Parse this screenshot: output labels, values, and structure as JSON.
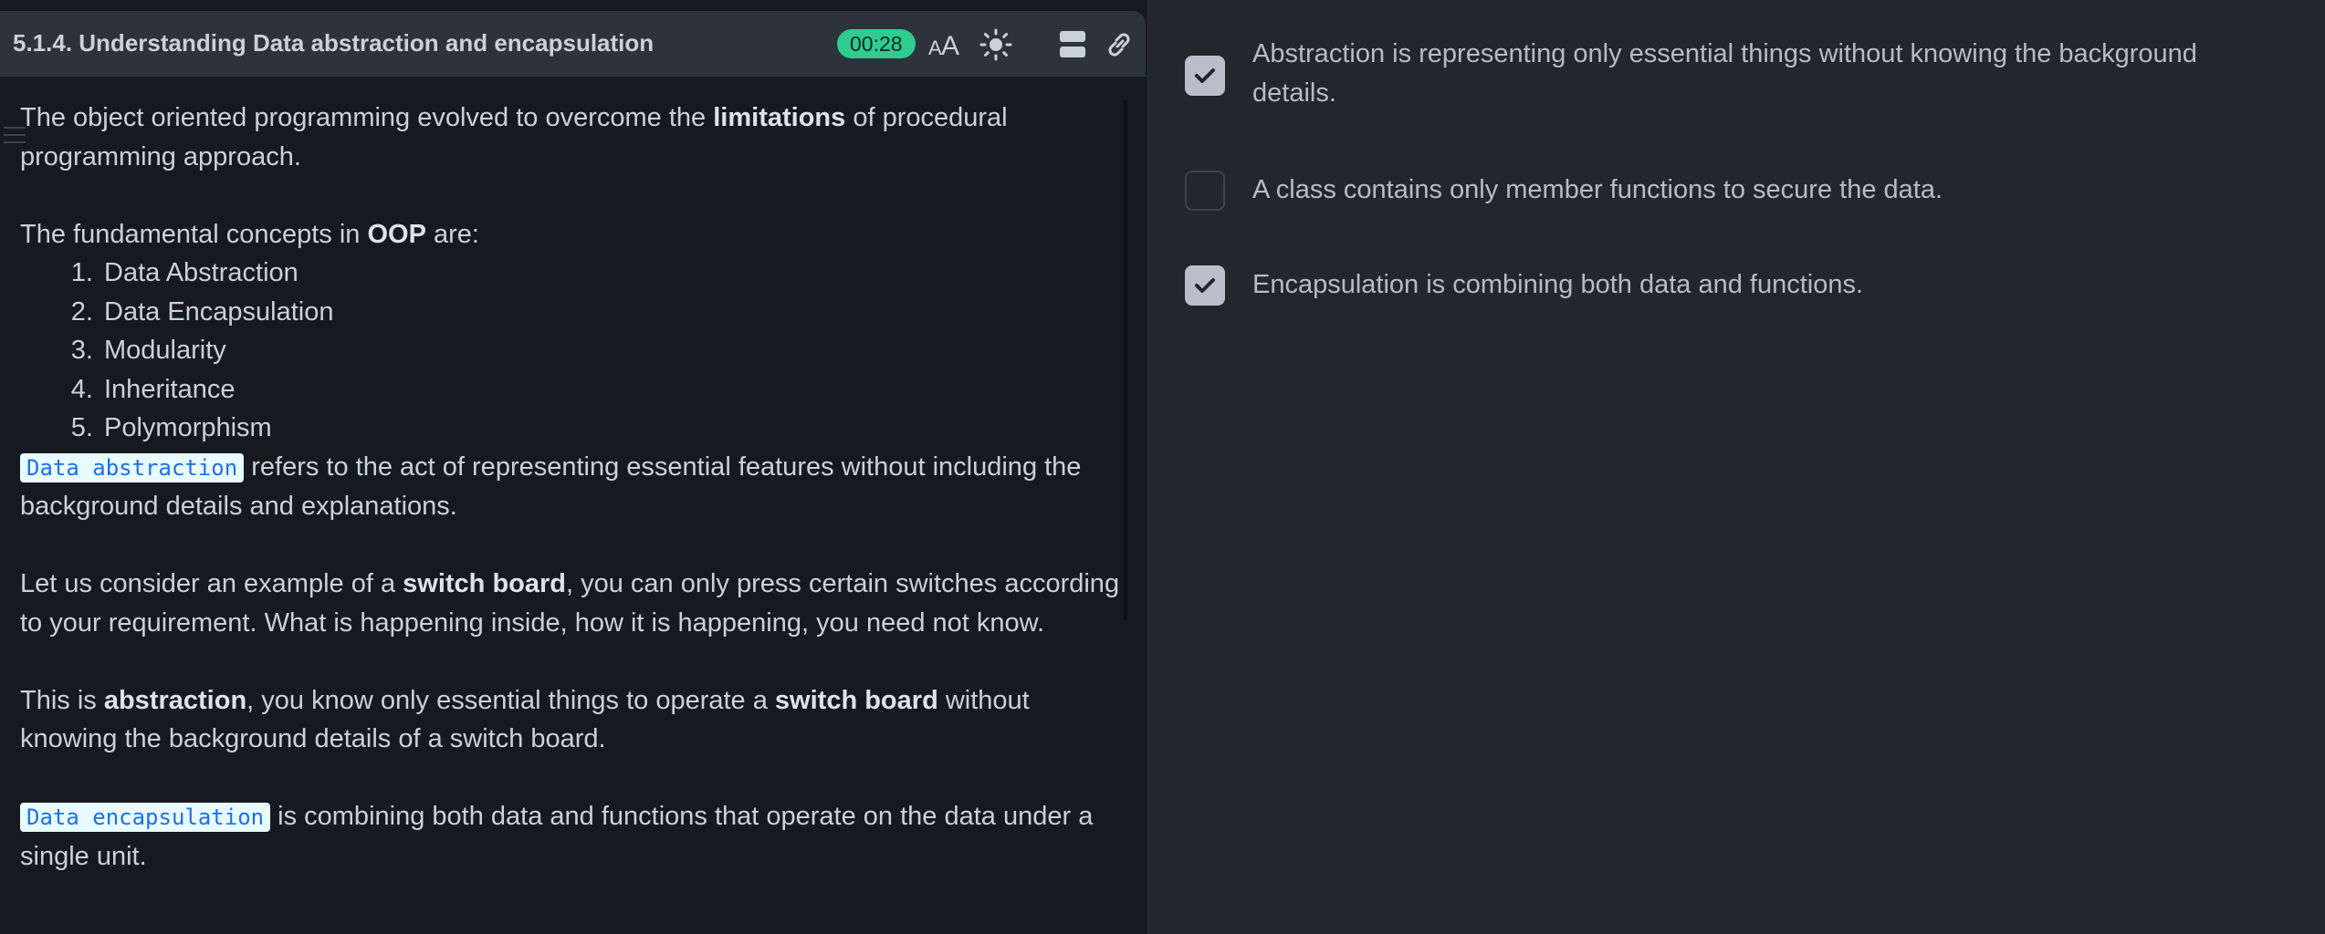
{
  "header": {
    "title": "5.1.4. Understanding Data abstraction and encapsulation",
    "timer": "00:28",
    "icons": [
      "font-size-icon",
      "brightness-icon",
      "layout-icon",
      "link-icon"
    ]
  },
  "content": {
    "p1_pre": "The object oriented programming evolved to overcome the ",
    "p1_bold": "limitations",
    "p1_post": " of procedural programming approach.",
    "p2_pre": "The fundamental concepts in ",
    "p2_bold": "OOP",
    "p2_post": " are:",
    "concepts": [
      "Data Abstraction",
      "Data Encapsulation",
      "Modularity",
      "Inheritance",
      "Polymorphism"
    ],
    "p3_code": "Data abstraction",
    "p3_post": " refers to the act of representing essential features without including the background details and explanations.",
    "p4_pre": "Let us consider an example of a ",
    "p4_bold": "switch board",
    "p4_post": ", you can only press certain switches according to your requirement. What is happening inside, how it is happening, you need not know.",
    "p5_pre": "This is ",
    "p5_bold1": "abstraction",
    "p5_mid": ", you know only essential things to operate a ",
    "p5_bold2": "switch board",
    "p5_post": " without knowing the background details of a switch board.",
    "p6_code": "Data encapsulation",
    "p6_post": " is combining both data and functions that operate on the data under a single unit."
  },
  "options": [
    {
      "label": "Abstraction is representing only essential things without knowing the background details.",
      "checked": true
    },
    {
      "label": "A class contains only member functions to secure the data.",
      "checked": false
    },
    {
      "label": "Encapsulation is combining both data and functions.",
      "checked": true
    }
  ],
  "colors": {
    "timer_bg": "#2ecc8f",
    "code_bg": "#e8fbff",
    "code_text": "#1f6feb",
    "checkbox_on": "#b9bfca"
  }
}
